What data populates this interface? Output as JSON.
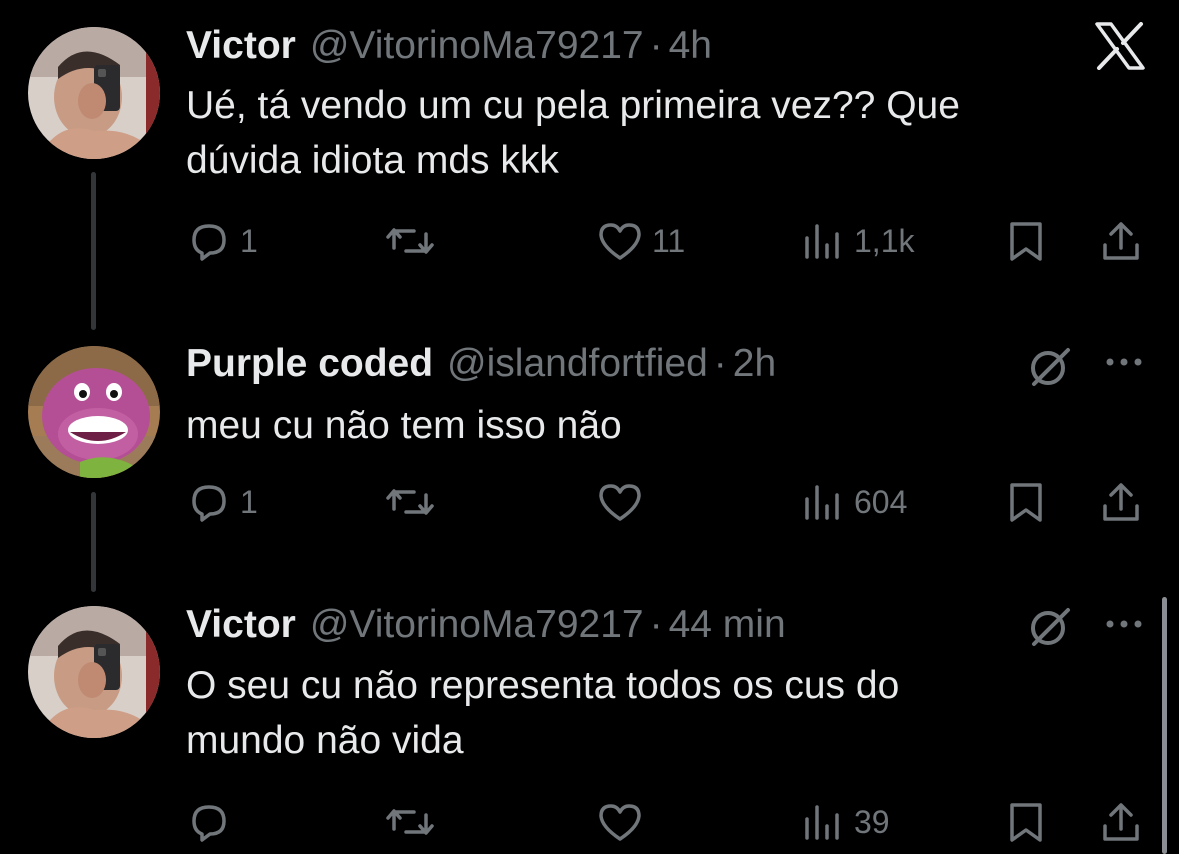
{
  "tweets": [
    {
      "name": "Victor",
      "handle": "@VitorinoMa79217",
      "sep": "·",
      "time": "4h",
      "lines": [
        "Ué, tá vendo um cu pela primeira vez?? Que",
        "dúvida idiota mds kkk"
      ],
      "replies": "1",
      "reposts": "",
      "likes": "11",
      "views": "1,1k"
    },
    {
      "name": "Purple coded",
      "handle": "@islandfortfied",
      "sep": "·",
      "time": "2h",
      "lines": [
        "meu cu não tem isso não"
      ],
      "replies": "1",
      "reposts": "",
      "likes": "",
      "views": "604"
    },
    {
      "name": "Victor",
      "handle": "@VitorinoMa79217",
      "sep": "·",
      "time": "44 min",
      "lines": [
        "O seu cu não representa todos os cus do",
        "mundo não vida"
      ],
      "replies": "",
      "reposts": "",
      "likes": "",
      "views": "39"
    }
  ],
  "icons": {
    "brand": "x-logo-icon",
    "reply": "reply-icon",
    "repost": "repost-icon",
    "like": "heart-icon",
    "views": "views-icon",
    "bookmark": "bookmark-icon",
    "share": "share-icon",
    "grok": "grok-icon",
    "more": "more-icon"
  },
  "colors": {
    "background": "#000000",
    "text": "#e7e9ea",
    "secondary": "#71767b",
    "thread_line": "#333639"
  }
}
